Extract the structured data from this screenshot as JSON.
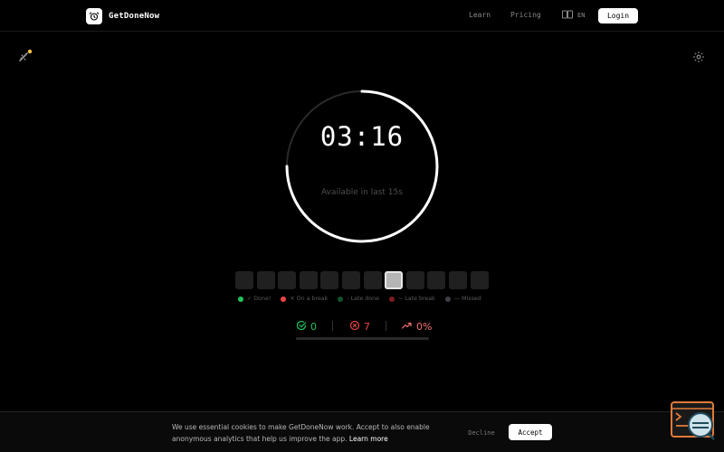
{
  "header": {
    "brand": "GetDoneNow",
    "nav": {
      "learn": "Learn",
      "pricing": "Pricing"
    },
    "language": "EN",
    "login": "Login"
  },
  "timer": {
    "time": "03:16",
    "subtitle": "Available in last 15s",
    "progress_fraction": 0.75
  },
  "slots": {
    "total": 12,
    "active_index": 7
  },
  "legend": [
    {
      "label": "✓ Done!",
      "color": "#22c55e"
    },
    {
      "label": "✕ On a break",
      "color": "#ef4444"
    },
    {
      "label": "- Late done",
      "color": "#14532d"
    },
    {
      "label": "~ Late break",
      "color": "#7f1d1d"
    },
    {
      "label": "— Missed",
      "color": "#3f3f46"
    }
  ],
  "stats": {
    "done": "0",
    "missed": "7",
    "rate": "0%",
    "colors": {
      "done": "#22c55e",
      "missed": "#ef4444",
      "rate": "#f87171"
    }
  },
  "cookie": {
    "text": "We use essential cookies to make GetDoneNow work. Accept to also enable anonymous analytics that help us improve the app.",
    "link": "Learn more",
    "decline": "Decline",
    "accept": "Accept"
  },
  "icons": {
    "logo": "alarm-clock-icon",
    "language": "book-icon",
    "tool": "wand-sparkle-icon",
    "settings": "gear-icon",
    "helper": "terminal-avatar-icon"
  }
}
